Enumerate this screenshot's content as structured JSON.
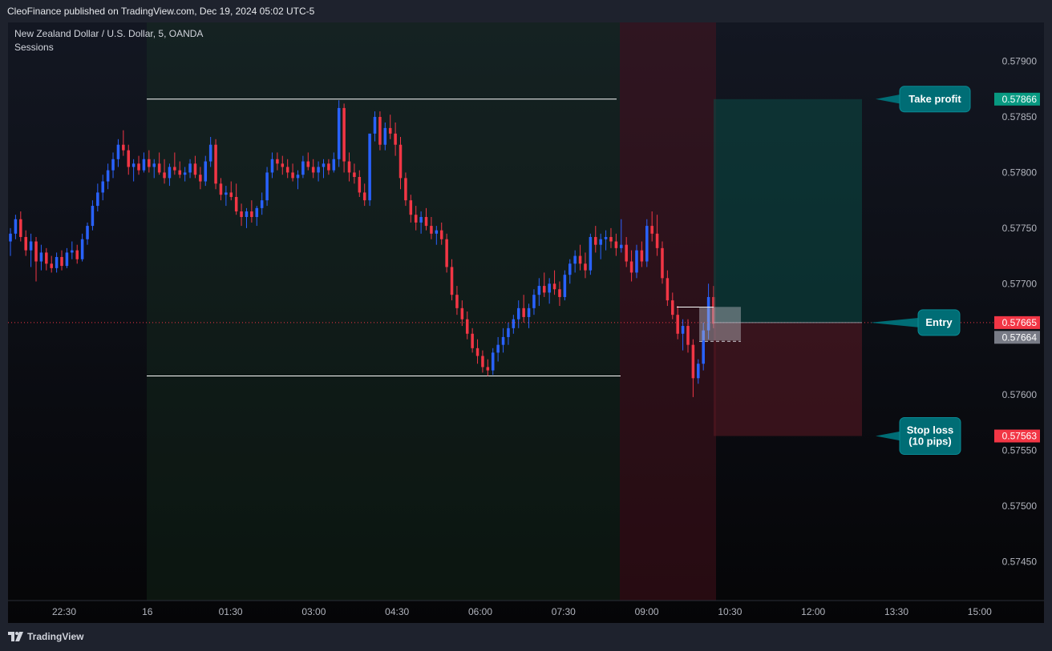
{
  "header": {
    "published": "CleoFinance published on TradingView.com, Dec 19, 2024 05:02 UTC-5"
  },
  "legend": {
    "symbol": "New Zealand Dollar / U.S. Dollar, 5, OANDA",
    "indicator": "Sessions"
  },
  "footer": {
    "brand": "TradingView",
    "logo_icon": "tradingview-logo-icon"
  },
  "colors": {
    "bull": "#2962ff",
    "bear": "#f23645",
    "tp_tag": "#089981",
    "sl_tag": "#f23645",
    "entry_tag": "#f23645",
    "price_tag": "#787b86",
    "callout": "#006d75"
  },
  "chart_data": {
    "type": "candlestick",
    "ylim": [
      0.57415,
      0.57935
    ],
    "y_ticks": [
      "0.57900",
      "0.57850",
      "0.57800",
      "0.57750",
      "0.57700",
      "0.57650",
      "0.57600",
      "0.57550",
      "0.57500",
      "0.57450"
    ],
    "x_ticks": [
      "22:30",
      "16",
      "01:30",
      "03:00",
      "04:30",
      "06:00",
      "07:30",
      "09:00",
      "10:30",
      "12:00",
      "13:30",
      "15:00"
    ],
    "price_tags": [
      {
        "label": "0.57866",
        "value": 0.57866,
        "role": "take-profit"
      },
      {
        "label": "0.57665",
        "value": 0.57665,
        "role": "entry"
      },
      {
        "label": "0.57664",
        "value": 0.57664,
        "role": "last-price"
      },
      {
        "label": "0.57563",
        "value": 0.57563,
        "role": "stop-loss"
      }
    ],
    "annotations": [
      {
        "text": "Take profit",
        "value": 0.57866
      },
      {
        "text": "Entry",
        "value": 0.57665
      },
      {
        "text": "Stop loss\n(10 pips)",
        "value": 0.57563
      }
    ],
    "levels": [
      {
        "name": "session-high",
        "value": 0.57866
      },
      {
        "name": "session-low",
        "value": 0.57617
      }
    ],
    "position": {
      "entry": 0.57665,
      "take_profit": 0.57866,
      "stop_loss": 0.57563
    },
    "candles": [
      [
        0.57738,
        0.5775,
        0.57725,
        0.57745
      ],
      [
        0.57745,
        0.57762,
        0.5774,
        0.57758
      ],
      [
        0.57758,
        0.57765,
        0.57738,
        0.57742
      ],
      [
        0.57742,
        0.57748,
        0.57725,
        0.5773
      ],
      [
        0.5773,
        0.57745,
        0.57715,
        0.57738
      ],
      [
        0.57738,
        0.57742,
        0.57702,
        0.5772
      ],
      [
        0.5772,
        0.57735,
        0.57712,
        0.57728
      ],
      [
        0.57728,
        0.57732,
        0.57712,
        0.57718
      ],
      [
        0.57718,
        0.57725,
        0.5771,
        0.57714
      ],
      [
        0.57714,
        0.57728,
        0.5771,
        0.57724
      ],
      [
        0.57724,
        0.5773,
        0.57712,
        0.57716
      ],
      [
        0.57716,
        0.57732,
        0.57714,
        0.57728
      ],
      [
        0.57728,
        0.57738,
        0.57722,
        0.5773
      ],
      [
        0.5773,
        0.57735,
        0.57718,
        0.57722
      ],
      [
        0.57722,
        0.57745,
        0.5772,
        0.5774
      ],
      [
        0.5774,
        0.57755,
        0.57735,
        0.57752
      ],
      [
        0.57752,
        0.57775,
        0.57748,
        0.5777
      ],
      [
        0.5777,
        0.5779,
        0.57765,
        0.57782
      ],
      [
        0.57782,
        0.57798,
        0.57775,
        0.57792
      ],
      [
        0.57792,
        0.57808,
        0.57785,
        0.57802
      ],
      [
        0.57802,
        0.57818,
        0.57795,
        0.57812
      ],
      [
        0.57812,
        0.5783,
        0.57805,
        0.57825
      ],
      [
        0.57825,
        0.57838,
        0.57815,
        0.5782
      ],
      [
        0.5782,
        0.57825,
        0.57798,
        0.57805
      ],
      [
        0.57805,
        0.57812,
        0.57792,
        0.57808
      ],
      [
        0.57808,
        0.57815,
        0.57798,
        0.57802
      ],
      [
        0.57802,
        0.57818,
        0.578,
        0.57812
      ],
      [
        0.57812,
        0.5782,
        0.578,
        0.57805
      ],
      [
        0.57805,
        0.57812,
        0.57795,
        0.57808
      ],
      [
        0.57808,
        0.57818,
        0.57798,
        0.578
      ],
      [
        0.578,
        0.57812,
        0.5779,
        0.57795
      ],
      [
        0.57795,
        0.57808,
        0.57788,
        0.57805
      ],
      [
        0.57805,
        0.57818,
        0.57798,
        0.57802
      ],
      [
        0.57802,
        0.5781,
        0.57795,
        0.57798
      ],
      [
        0.57798,
        0.57805,
        0.57792,
        0.578
      ],
      [
        0.578,
        0.57812,
        0.57795,
        0.57808
      ],
      [
        0.57808,
        0.57815,
        0.57795,
        0.57798
      ],
      [
        0.57798,
        0.57805,
        0.57785,
        0.57792
      ],
      [
        0.57792,
        0.57815,
        0.57788,
        0.5781
      ],
      [
        0.5781,
        0.57832,
        0.57805,
        0.57825
      ],
      [
        0.57825,
        0.5783,
        0.57785,
        0.5779
      ],
      [
        0.5779,
        0.57795,
        0.57775,
        0.5778
      ],
      [
        0.5778,
        0.57788,
        0.5777,
        0.57782
      ],
      [
        0.57782,
        0.57792,
        0.57775,
        0.57778
      ],
      [
        0.57778,
        0.5779,
        0.57762,
        0.57765
      ],
      [
        0.57765,
        0.57772,
        0.57752,
        0.5776
      ],
      [
        0.5776,
        0.57768,
        0.5775,
        0.57765
      ],
      [
        0.57765,
        0.57775,
        0.57755,
        0.5776
      ],
      [
        0.5776,
        0.5777,
        0.57752,
        0.57768
      ],
      [
        0.57768,
        0.57782,
        0.57762,
        0.57775
      ],
      [
        0.57775,
        0.57805,
        0.5777,
        0.578
      ],
      [
        0.578,
        0.57818,
        0.57795,
        0.57812
      ],
      [
        0.57812,
        0.57818,
        0.57802,
        0.57808
      ],
      [
        0.57808,
        0.57815,
        0.57798,
        0.57805
      ],
      [
        0.57805,
        0.57812,
        0.57795,
        0.578
      ],
      [
        0.578,
        0.57808,
        0.57792,
        0.57795
      ],
      [
        0.57795,
        0.57802,
        0.57785,
        0.57798
      ],
      [
        0.57798,
        0.57815,
        0.57795,
        0.5781
      ],
      [
        0.5781,
        0.57818,
        0.57802,
        0.57805
      ],
      [
        0.57805,
        0.57812,
        0.57795,
        0.578
      ],
      [
        0.578,
        0.5781,
        0.57792,
        0.57805
      ],
      [
        0.57805,
        0.57812,
        0.57795,
        0.57808
      ],
      [
        0.57808,
        0.57812,
        0.57798,
        0.57802
      ],
      [
        0.57802,
        0.57818,
        0.578,
        0.57812
      ],
      [
        0.57812,
        0.57865,
        0.57805,
        0.57858
      ],
      [
        0.57858,
        0.57862,
        0.578,
        0.5781
      ],
      [
        0.5781,
        0.57818,
        0.57792,
        0.578
      ],
      [
        0.578,
        0.57808,
        0.5779,
        0.57796
      ],
      [
        0.57796,
        0.57802,
        0.57778,
        0.57782
      ],
      [
        0.57782,
        0.5779,
        0.5777,
        0.57775
      ],
      [
        0.57775,
        0.57815,
        0.5777,
        0.57835
      ],
      [
        0.57835,
        0.57855,
        0.57828,
        0.5785
      ],
      [
        0.5785,
        0.57855,
        0.5782,
        0.57825
      ],
      [
        0.57825,
        0.57845,
        0.5782,
        0.5784
      ],
      [
        0.5784,
        0.57852,
        0.5783,
        0.57835
      ],
      [
        0.57835,
        0.57845,
        0.57815,
        0.57825
      ],
      [
        0.57825,
        0.57832,
        0.57785,
        0.57795
      ],
      [
        0.57795,
        0.578,
        0.5777,
        0.57775
      ],
      [
        0.57775,
        0.5778,
        0.57755,
        0.57762
      ],
      [
        0.57762,
        0.5777,
        0.57748,
        0.57755
      ],
      [
        0.57755,
        0.57765,
        0.57745,
        0.5776
      ],
      [
        0.5776,
        0.57768,
        0.57748,
        0.57752
      ],
      [
        0.57752,
        0.5776,
        0.5774,
        0.57745
      ],
      [
        0.57745,
        0.57752,
        0.57735,
        0.57748
      ],
      [
        0.57748,
        0.57755,
        0.57735,
        0.5774
      ],
      [
        0.5774,
        0.57745,
        0.5771,
        0.57715
      ],
      [
        0.57715,
        0.57722,
        0.57685,
        0.5769
      ],
      [
        0.5769,
        0.57698,
        0.57672,
        0.57678
      ],
      [
        0.57678,
        0.57685,
        0.57662,
        0.57668
      ],
      [
        0.57668,
        0.57675,
        0.5765,
        0.57655
      ],
      [
        0.57655,
        0.5766,
        0.57638,
        0.57642
      ],
      [
        0.57642,
        0.5765,
        0.57628,
        0.57635
      ],
      [
        0.57635,
        0.5764,
        0.5762,
        0.57625
      ],
      [
        0.57625,
        0.57632,
        0.57617,
        0.57622
      ],
      [
        0.57622,
        0.57642,
        0.57618,
        0.57638
      ],
      [
        0.57638,
        0.57652,
        0.5763,
        0.57645
      ],
      [
        0.57645,
        0.5766,
        0.57638,
        0.57652
      ],
      [
        0.57652,
        0.57665,
        0.57645,
        0.5766
      ],
      [
        0.5766,
        0.57672,
        0.57655,
        0.57668
      ],
      [
        0.57668,
        0.57685,
        0.5766,
        0.57678
      ],
      [
        0.57678,
        0.5769,
        0.57665,
        0.5767
      ],
      [
        0.5767,
        0.57682,
        0.5766,
        0.57678
      ],
      [
        0.57678,
        0.57695,
        0.57672,
        0.5769
      ],
      [
        0.5769,
        0.57705,
        0.5768,
        0.57698
      ],
      [
        0.57698,
        0.5771,
        0.57688,
        0.57692
      ],
      [
        0.57692,
        0.57705,
        0.57682,
        0.577
      ],
      [
        0.577,
        0.57712,
        0.5769,
        0.57695
      ],
      [
        0.57695,
        0.57702,
        0.5768,
        0.57688
      ],
      [
        0.57688,
        0.57712,
        0.57685,
        0.57708
      ],
      [
        0.57708,
        0.57722,
        0.577,
        0.57718
      ],
      [
        0.57718,
        0.5773,
        0.5771,
        0.57725
      ],
      [
        0.57725,
        0.57735,
        0.57712,
        0.57718
      ],
      [
        0.57718,
        0.57728,
        0.57705,
        0.57712
      ],
      [
        0.57712,
        0.57745,
        0.57708,
        0.57742
      ],
      [
        0.57742,
        0.57752,
        0.57728,
        0.57735
      ],
      [
        0.57735,
        0.57745,
        0.57722,
        0.5774
      ],
      [
        0.5774,
        0.57748,
        0.5773,
        0.57742
      ],
      [
        0.57742,
        0.5775,
        0.57732,
        0.57738
      ],
      [
        0.57738,
        0.57745,
        0.57725,
        0.57732
      ],
      [
        0.57732,
        0.57758,
        0.57728,
        0.57735
      ],
      [
        0.57735,
        0.57742,
        0.57715,
        0.5772
      ],
      [
        0.5772,
        0.5773,
        0.57702,
        0.5771
      ],
      [
        0.5771,
        0.57735,
        0.57705,
        0.5773
      ],
      [
        0.5773,
        0.57738,
        0.57715,
        0.5772
      ],
      [
        0.5772,
        0.57758,
        0.57715,
        0.57752
      ],
      [
        0.57752,
        0.57765,
        0.57738,
        0.57745
      ],
      [
        0.57745,
        0.57762,
        0.57725,
        0.57732
      ],
      [
        0.57732,
        0.57738,
        0.577,
        0.57705
      ],
      [
        0.57705,
        0.57712,
        0.5768,
        0.57685
      ],
      [
        0.57685,
        0.57692,
        0.57668,
        0.57672
      ],
      [
        0.57672,
        0.5768,
        0.5765,
        0.57655
      ],
      [
        0.57655,
        0.57668,
        0.5764,
        0.57662
      ],
      [
        0.57662,
        0.57668,
        0.57638,
        0.57645
      ],
      [
        0.57645,
        0.5765,
        0.57598,
        0.57615
      ],
      [
        0.57615,
        0.57632,
        0.5761,
        0.57628
      ],
      [
        0.57628,
        0.57665,
        0.57622,
        0.57658
      ],
      [
        0.57658,
        0.577,
        0.5765,
        0.57688
      ],
      [
        0.57688,
        0.57698,
        0.5766,
        0.57664
      ]
    ]
  }
}
